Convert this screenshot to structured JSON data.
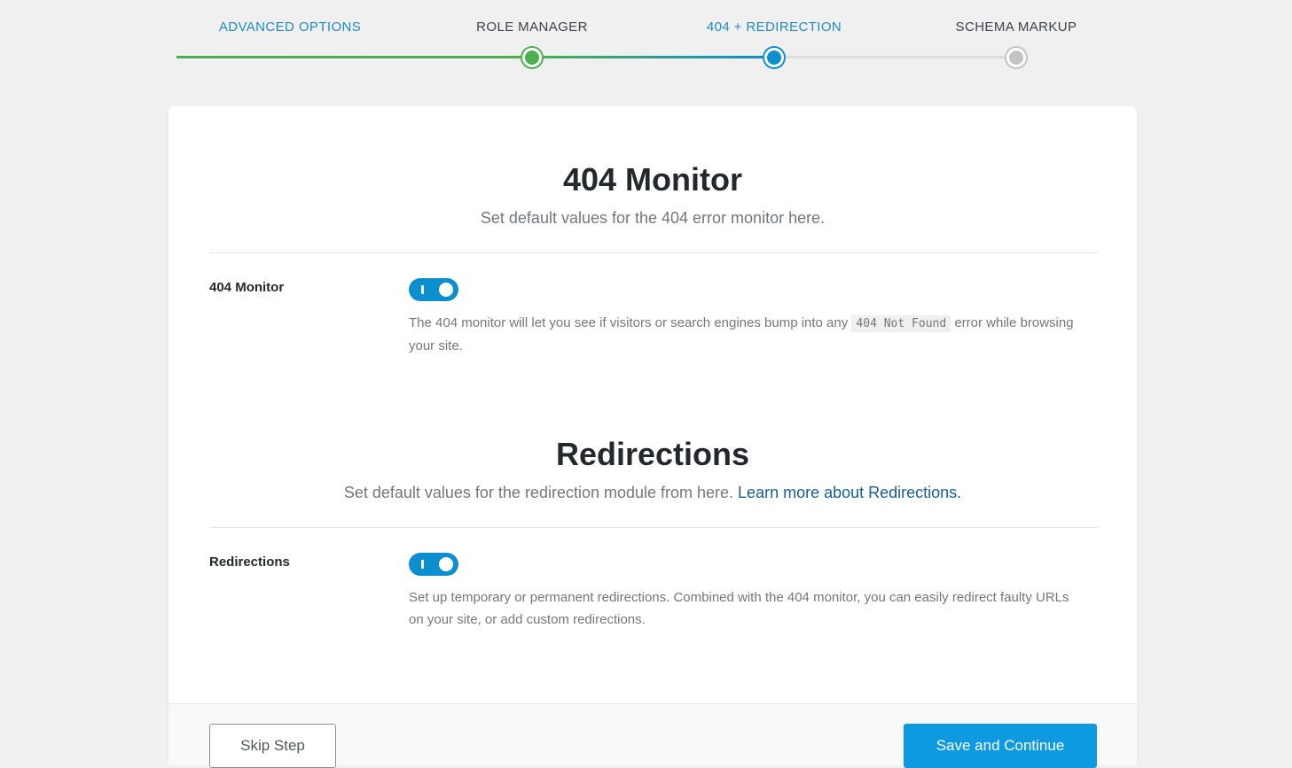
{
  "steps": [
    {
      "label": "ADVANCED OPTIONS",
      "status": "done"
    },
    {
      "label": "ROLE MANAGER",
      "status": "done"
    },
    {
      "label": "404 + REDIRECTION",
      "status": "current"
    },
    {
      "label": "SCHEMA MARKUP",
      "status": "pending"
    }
  ],
  "colors": {
    "accent_blue": "#0d8ecf",
    "done_green": "#4caf50",
    "pending_grey": "#c3c4c7",
    "link": "#135e96"
  },
  "monitor": {
    "title": "404 Monitor",
    "subtitle": "Set default values for the 404 error monitor here.",
    "field_label": "404 Monitor",
    "toggle_on": true,
    "desc_before": "The 404 monitor will let you see if visitors or search engines bump into any ",
    "desc_code": "404 Not Found",
    "desc_after": " error while browsing your site."
  },
  "redirections": {
    "title": "Redirections",
    "subtitle": "Set default values for the redirection module from here. ",
    "subtitle_link": "Learn more about Redirections.",
    "field_label": "Redirections",
    "toggle_on": true,
    "desc": "Set up temporary or permanent redirections. Combined with the 404 monitor, you can easily redirect faulty URLs on your site, or add custom redirections."
  },
  "footer": {
    "skip_label": "Skip Step",
    "save_label": "Save and Continue"
  }
}
